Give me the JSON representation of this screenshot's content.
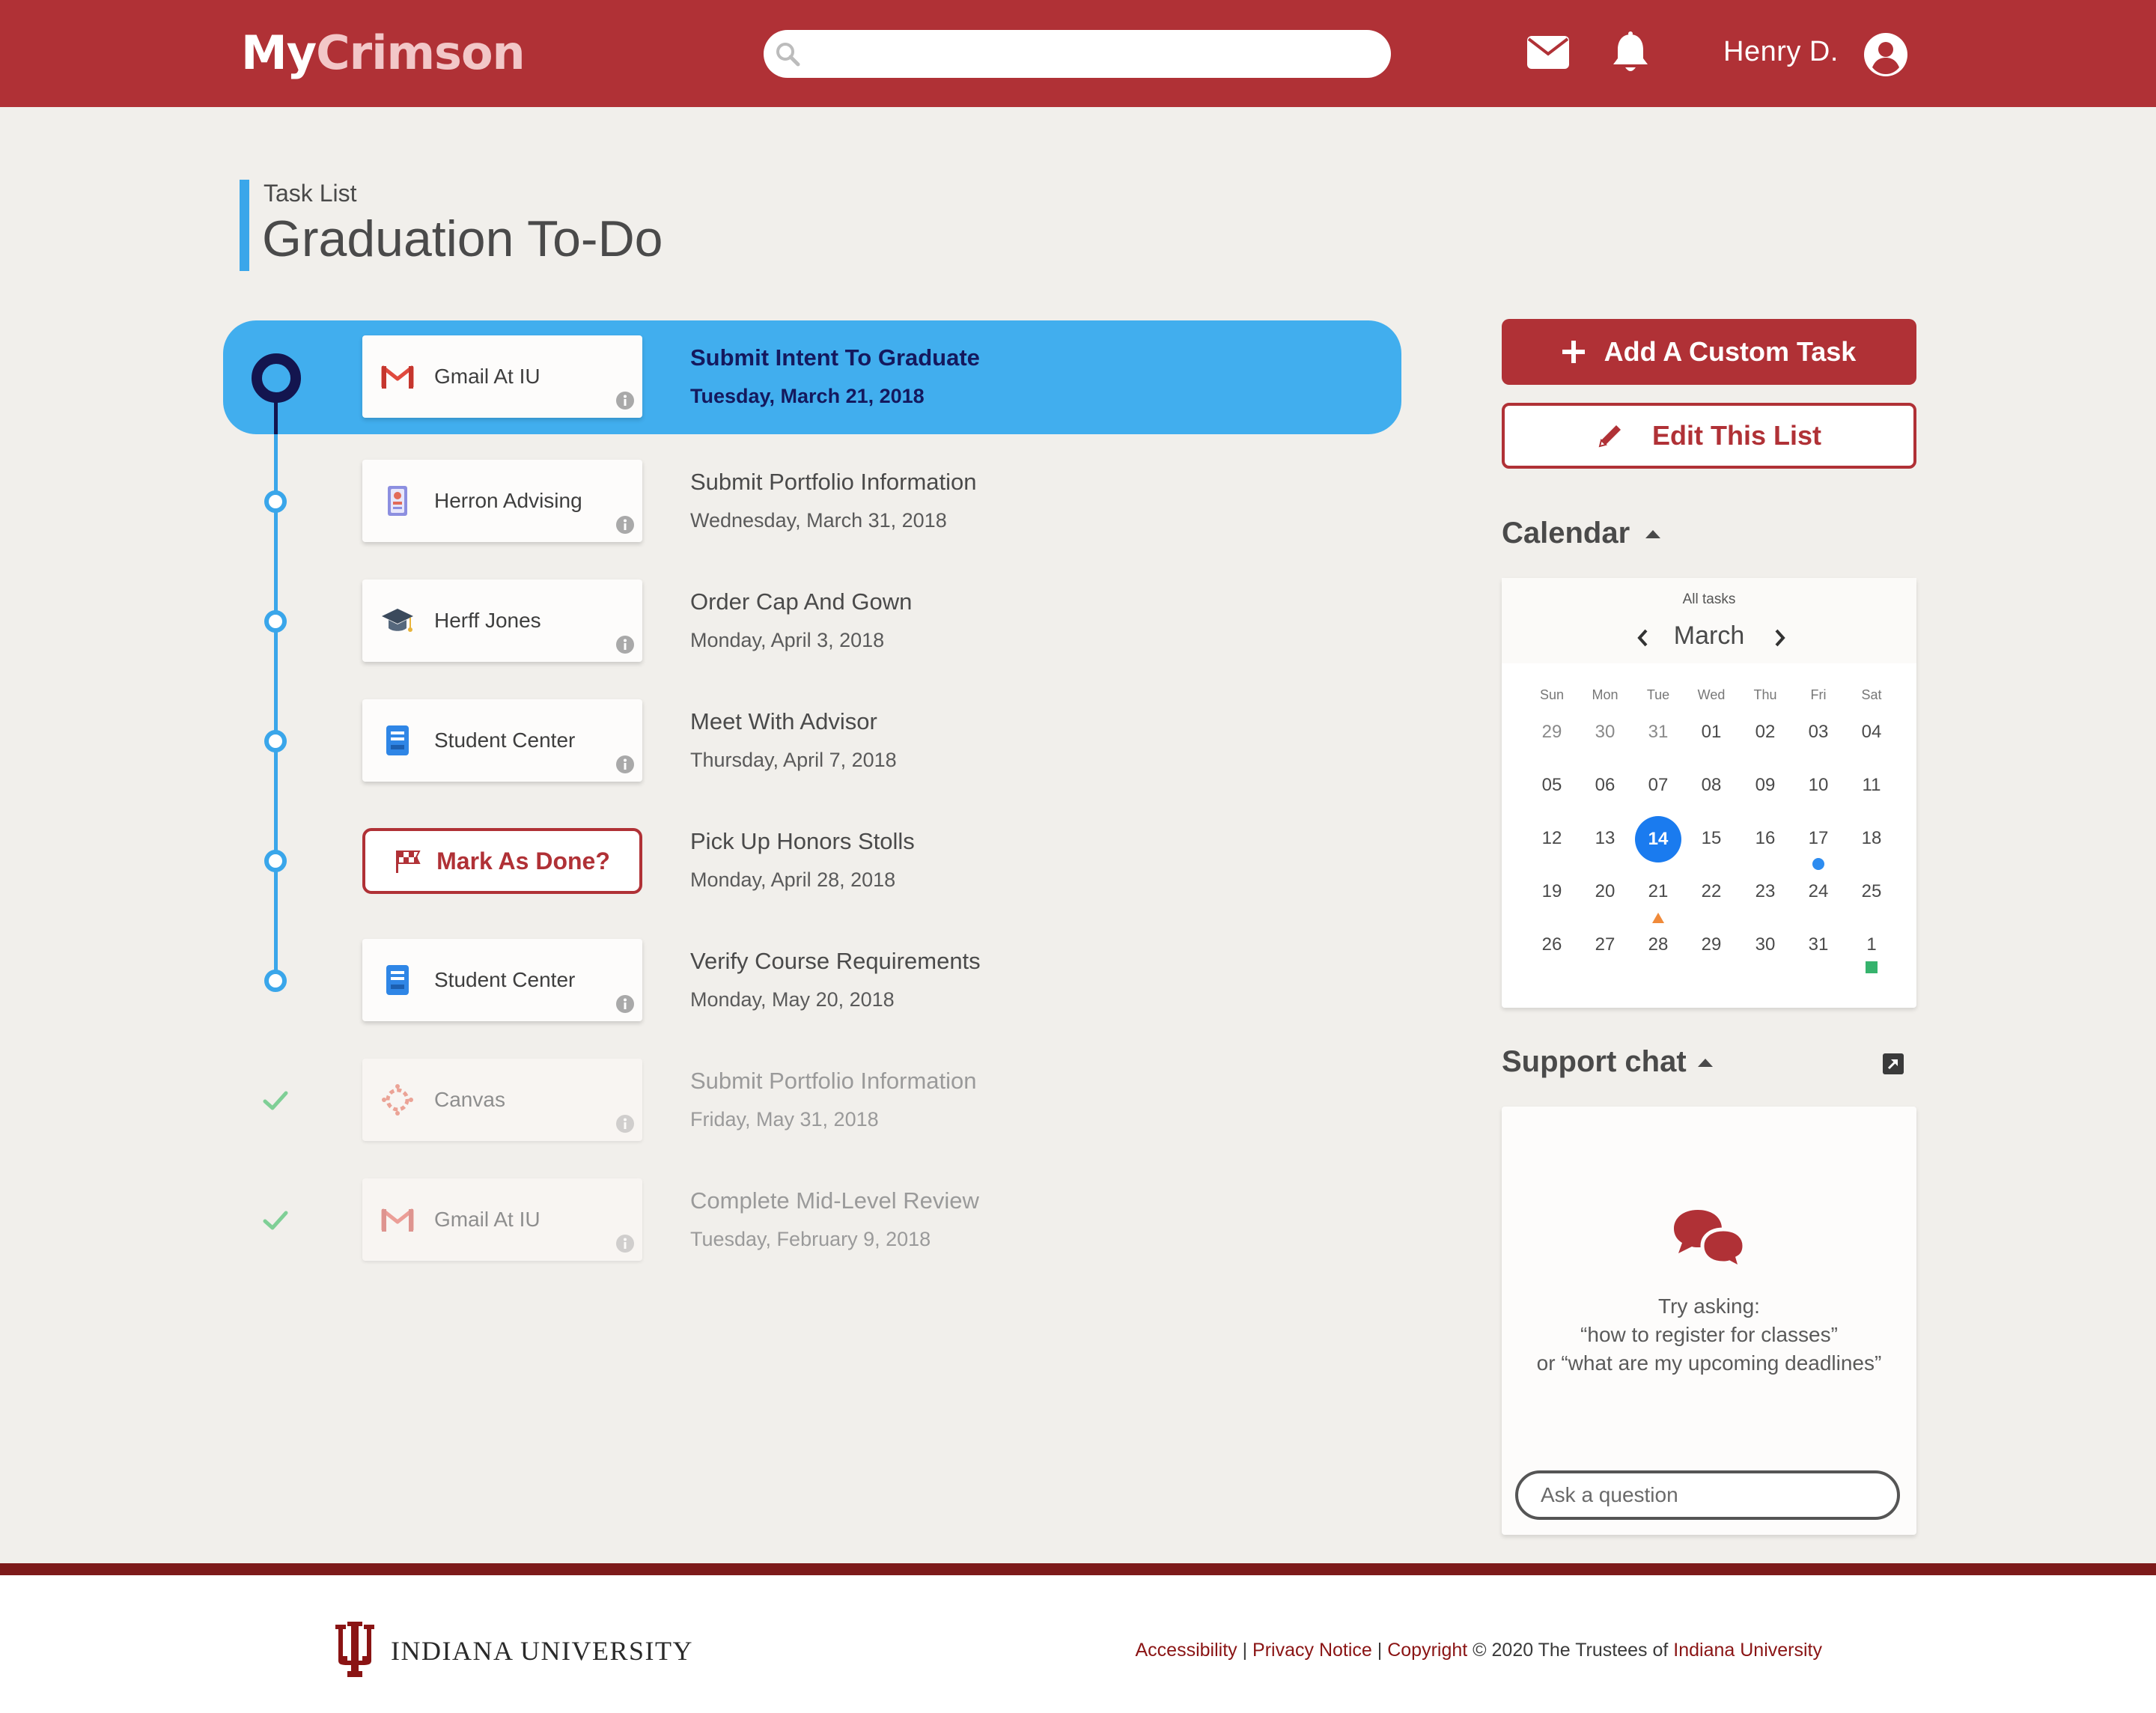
{
  "header": {
    "logo_part1": "My",
    "logo_part2": "Crimson",
    "search_placeholder": "",
    "username": "Henry D.",
    "icons": [
      "search-icon",
      "mail-icon",
      "bell-icon",
      "user-avatar-icon"
    ]
  },
  "page": {
    "subtitle": "Task List",
    "title": "Graduation To-Do"
  },
  "tasks": [
    {
      "source": "Gmail At IU",
      "name": "Submit Intent To Graduate",
      "date": "Tuesday, March 21, 2018",
      "status": "active",
      "icon": "gmail-icon"
    },
    {
      "source": "Herron Advising",
      "name": "Submit Portfolio Information",
      "date": "Wednesday, March 31, 2018",
      "status": "pending",
      "icon": "contact-card-icon"
    },
    {
      "source": "Herff Jones",
      "name": "Order Cap And Gown",
      "date": "Monday, April 3, 2018",
      "status": "pending",
      "icon": "graduation-cap-icon"
    },
    {
      "source": "Student Center",
      "name": "Meet With Advisor",
      "date": "Thursday, April 7, 2018",
      "status": "pending",
      "icon": "notebook-icon"
    },
    {
      "source": "Mark As Done?",
      "name": "Pick Up Honors Stolls",
      "date": "Monday, April 28, 2018",
      "status": "pending",
      "icon": "checkered-flag-icon"
    },
    {
      "source": "Student Center",
      "name": "Verify Course Requirements",
      "date": "Monday, May 20, 2018",
      "status": "pending",
      "icon": "notebook-icon"
    },
    {
      "source": "Canvas",
      "name": "Submit Portfolio Information",
      "date": "Friday, May 31, 2018",
      "status": "done",
      "icon": "canvas-icon"
    },
    {
      "source": "Gmail At IU",
      "name": "Complete Mid-Level Review",
      "date": "Tuesday, February 9, 2018",
      "status": "done",
      "icon": "gmail-icon"
    }
  ],
  "actions": {
    "add_task": "Add A Custom Task",
    "edit_list": "Edit This List"
  },
  "calendar": {
    "section_title": "Calendar",
    "filter": "All tasks",
    "month": "March",
    "weekdays": [
      "Sun",
      "Mon",
      "Tue",
      "Wed",
      "Thu",
      "Fri",
      "Sat"
    ],
    "weeks": [
      [
        "29",
        "30",
        "31",
        "01",
        "02",
        "03",
        "04"
      ],
      [
        "05",
        "06",
        "07",
        "08",
        "09",
        "10",
        "11"
      ],
      [
        "12",
        "13",
        "14",
        "15",
        "16",
        "17",
        "18"
      ],
      [
        "19",
        "20",
        "21",
        "22",
        "23",
        "24",
        "25"
      ],
      [
        "26",
        "27",
        "28",
        "29",
        "30",
        "31",
        "1"
      ]
    ],
    "selected_day": "14",
    "markers": [
      {
        "day": "17",
        "shape": "dot",
        "color": "#2d8cf0"
      },
      {
        "day": "21",
        "shape": "triangle",
        "color": "#f08a3a"
      },
      {
        "day": "1",
        "shape": "square",
        "color": "#36b36d"
      }
    ]
  },
  "support_chat": {
    "section_title": "Support chat",
    "hint_line1": "Try asking:",
    "hint_line2": "“how to register for classes”",
    "hint_line3": "or “what are my upcoming deadlines”",
    "input_placeholder": "Ask a question"
  },
  "footer": {
    "university": "INDIANA UNIVERSITY",
    "link_accessibility": "Accessibility",
    "link_privacy": "Privacy Notice",
    "link_copyright": "Copyright",
    "copyright_text": "© 2020 The Trustees of",
    "link_university": "Indiana University",
    "separator": " | "
  },
  "colors": {
    "brand_crimson": "#b03136",
    "active_blue": "#41aeee",
    "timeline_blue": "#3aa6ea",
    "active_text_navy": "#14195e",
    "background": "#f1efeb"
  }
}
